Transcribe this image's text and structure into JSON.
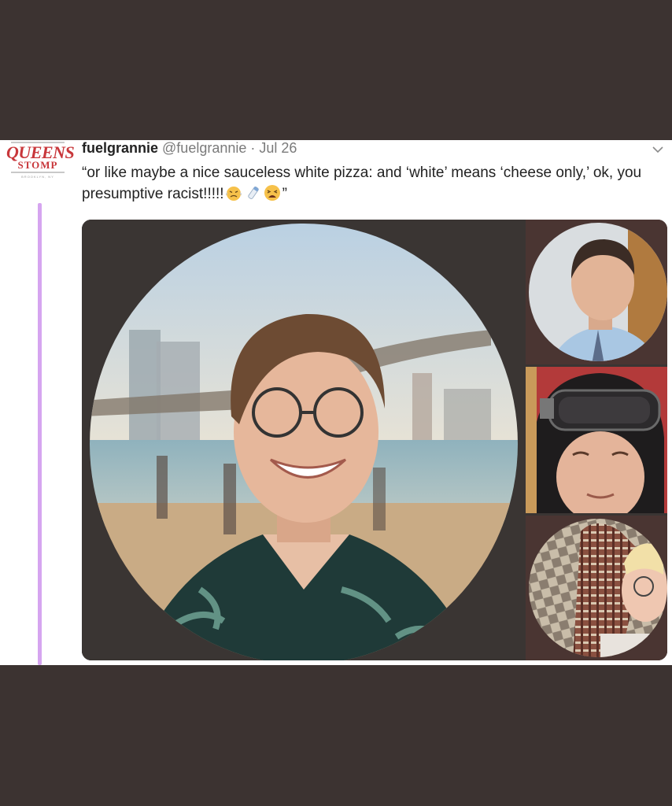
{
  "account_logo": {
    "line1": "QUEENS",
    "line2": "STOMP",
    "line3": "BROOKLYN, NY"
  },
  "tweet": {
    "display_name": "fuelgrannie",
    "handle": "@fuelgrannie",
    "separator": "·",
    "date": "Jul 26",
    "text": "“or like maybe a nice sauceless white pizza: and ‘white’ means ‘cheese only,’ ok, you presumptive racist!!!!!",
    "emoji_names": [
      "steaming-angry-face",
      "milk-bottle",
      "tired-face"
    ],
    "closing_quote": "”"
  },
  "media": {
    "photos": [
      {
        "name": "smiling-man-glasses-bridge-photo"
      },
      {
        "name": "man-blue-shirt-tie-photo"
      },
      {
        "name": "man-ski-helmet-goggles-photo"
      },
      {
        "name": "person-patterned-jacket-glasses-photo"
      }
    ]
  },
  "colors": {
    "page_background": "#3c3331",
    "card_background": "#ffffff",
    "thread_line": "#d6a5f0",
    "logo_red": "#c8373b",
    "muted_text": "#7a7a7a"
  }
}
